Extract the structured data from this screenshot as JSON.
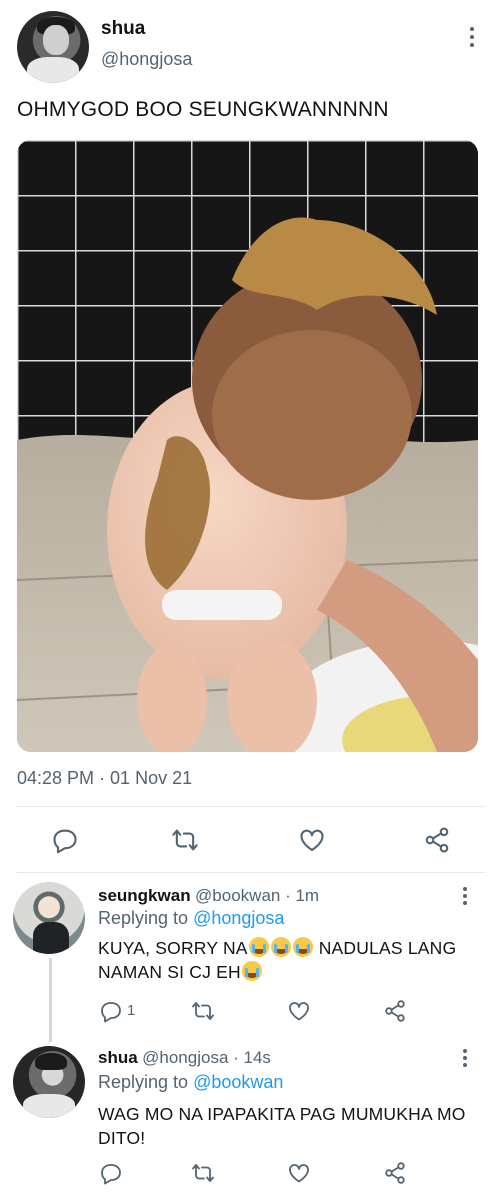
{
  "main_tweet": {
    "display_name": "shua",
    "handle": "@hongjosa",
    "text": "OHMYGOD BOO SEUNGKWANNNNN",
    "timestamp": "04:28 PM · 01 Nov 21",
    "icons": [
      "reply-icon",
      "retweet-icon",
      "like-icon",
      "share-icon"
    ]
  },
  "replies": [
    {
      "display_name": "seungkwan",
      "meta": "@bookwan · 1m",
      "replying_label": "Replying to ",
      "replying_handle": "@hongjosa",
      "text_line1": "KUYA, SORRY NA",
      "text_line1_tail": " NADULAS LANG",
      "text_line2": "NAMAN SI CJ EH",
      "reply_count": "1"
    },
    {
      "display_name": "shua",
      "meta": "@hongjosa · 14s",
      "replying_label": "Replying to ",
      "replying_handle": "@bookwan",
      "text": "WAG MO NA IPAPAKITA PAG MUMUKHA MO DITO!"
    }
  ],
  "colors": {
    "text": "#0f1419",
    "muted": "#536471",
    "link": "#1d9bf0",
    "divider": "#e6e9ec"
  }
}
